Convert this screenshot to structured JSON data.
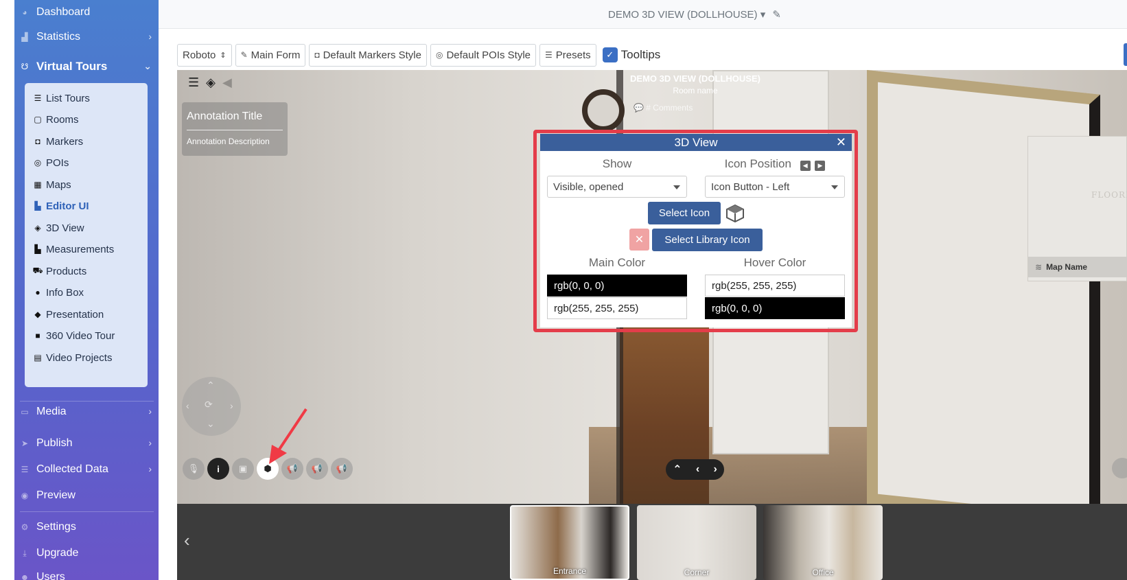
{
  "sidebar": {
    "items_top": [
      {
        "label": "Dashboard",
        "icon": "palette-icon"
      },
      {
        "label": "Statistics",
        "icon": "chart-icon"
      },
      {
        "label": "Virtual Tours",
        "icon": "tour-icon"
      }
    ],
    "submenu": [
      {
        "label": "List Tours",
        "icon": "list-icon"
      },
      {
        "label": "Rooms",
        "icon": "vector-square-icon"
      },
      {
        "label": "Markers",
        "icon": "caret-square-icon"
      },
      {
        "label": "POIs",
        "icon": "bullseye-icon"
      },
      {
        "label": "Maps",
        "icon": "map-icon"
      },
      {
        "label": "Editor UI",
        "icon": "swatchbook-icon"
      },
      {
        "label": "3D View",
        "icon": "cube-icon"
      },
      {
        "label": "Measurements",
        "icon": "ruler-icon"
      },
      {
        "label": "Products",
        "icon": "cart-icon"
      },
      {
        "label": "Info Box",
        "icon": "info-icon"
      },
      {
        "label": "Presentation",
        "icon": "diamond-icon"
      },
      {
        "label": "360 Video Tour",
        "icon": "video-icon"
      },
      {
        "label": "Video Projects",
        "icon": "film-icon"
      }
    ],
    "items_bottom": [
      {
        "label": "Media",
        "icon": "desktop-icon"
      },
      {
        "label": "Publish",
        "icon": "paper-plane-icon"
      },
      {
        "label": "Collected Data",
        "icon": "database-icon"
      },
      {
        "label": "Preview",
        "icon": "eye-icon"
      },
      {
        "label": "Settings",
        "icon": "cogs-icon"
      },
      {
        "label": "Upgrade",
        "icon": "download-icon"
      },
      {
        "label": "Users",
        "icon": "users-icon"
      }
    ]
  },
  "header": {
    "title": "DEMO 3D VIEW (DOLLHOUSE)"
  },
  "toolbar": {
    "font_select": "Roboto",
    "main_form": "Main Form",
    "default_markers_style": "Default Markers Style",
    "default_pois_style": "Default POIs Style",
    "presets": "Presets",
    "tooltips": "Tooltips"
  },
  "viewer": {
    "tour_title": "DEMO 3D VIEW (DOLLHOUSE)",
    "room_name": "Room name",
    "comments": "# Comments",
    "annotation_title": "Annotation Title",
    "annotation_description": "Annotation Description",
    "map_floor_label": "FLOORP",
    "map_name": "Map Name"
  },
  "popup": {
    "title": "3D View",
    "show_label": "Show",
    "show_value": "Visible, opened",
    "icon_position_label": "Icon Position",
    "icon_position_value": "Icon Button - Left",
    "select_icon": "Select Icon",
    "select_library_icon": "Select Library Icon",
    "main_color_label": "Main Color",
    "hover_color_label": "Hover Color",
    "main_color_1": "rgb(0, 0, 0)",
    "main_color_2": "rgb(255, 255, 255)",
    "hover_color_1": "rgb(255, 255, 255)",
    "hover_color_2": "rgb(0, 0, 0)"
  },
  "thumbnails": [
    {
      "label": "Entrance"
    },
    {
      "label": "Corner"
    },
    {
      "label": "Office"
    }
  ],
  "colors": {
    "accent": "#3a5f9b",
    "highlight_border": "#e43d4a",
    "sidebar_top": "#4a7fcf",
    "sidebar_bottom": "#6a55c8"
  }
}
